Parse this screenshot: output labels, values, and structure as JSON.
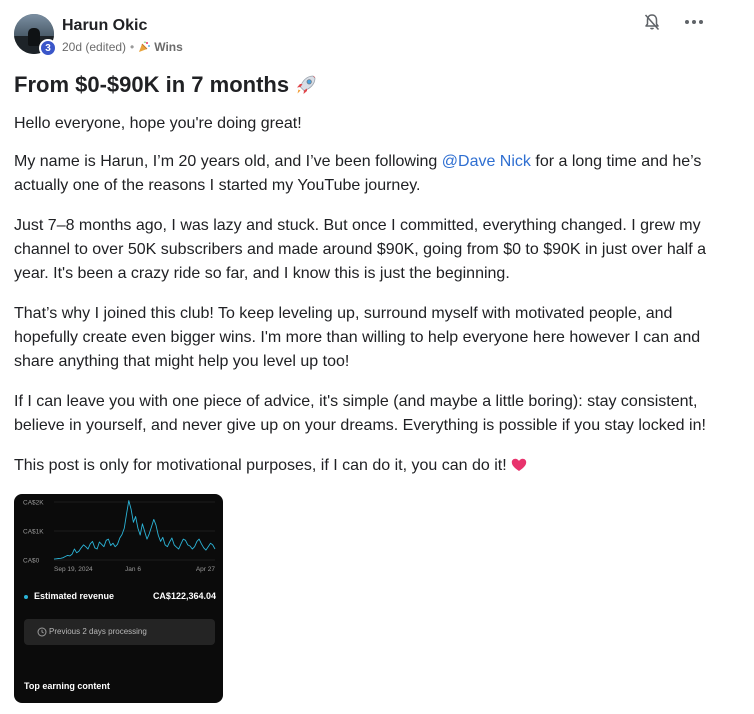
{
  "post": {
    "author": "Harun Okic",
    "level": "3",
    "time": "20d (edited)",
    "separator": "•",
    "category": "Wins",
    "title": "From $0-$90K in 7 months",
    "paragraphs": {
      "p1": "Hello everyone, hope you're doing great!",
      "p2_before": "My name is Harun, I’m 20 years old, and I’ve been following ",
      "p2_mention": "@Dave Nick",
      "p2_after": " for a long time and he’s actually one of the reasons I started my YouTube journey.",
      "p3": "Just 7–8 months ago, I was lazy and stuck. But once I committed, everything changed. I grew my channel to over 50K subscribers and made around $90K, going from $0 to $90K in just over half a year. It's been a crazy ride so far, and I know this is just the beginning.",
      "p4": "That’s why I joined this club! To keep leveling up, surround myself with motivated people, and hopefully create even bigger wins. I'm more than willing to help everyone here however I can and share anything that might help you level up too!",
      "p5": "If I can leave you with one piece of advice, it's simple (and maybe a little boring): stay consistent, believe in yourself, and never give up on your dreams. Everything is possible if you stay locked in!",
      "p6": "This post is only for motivational purposes, if I can do it, you can do it!"
    },
    "icons": {
      "bell": "bell-off-icon",
      "more": "more-horizontal-icon",
      "title_emoji": "rocket-icon",
      "end_emoji": "heart-icon",
      "category": "party-popper-icon"
    },
    "colors": {
      "mention": "#2f6fd1",
      "level_badge": "#3a56c9",
      "chart_line": "#2bb3d6",
      "heart": "#e8336d"
    }
  },
  "attachment": {
    "revenue_label": "Estimated revenue",
    "revenue_value": "CA$122,364.04",
    "processing_note": "Previous 2 days processing",
    "top_earning": "Top earning content",
    "chart_data": {
      "type": "line",
      "y_tick_labels": [
        "CA$2K",
        "CA$1K",
        "CA$0"
      ],
      "x_tick_labels": [
        "Sep 19, 2024",
        "Jan 6",
        "Apr 27"
      ],
      "ylim": [
        0,
        2000
      ],
      "series": [
        {
          "values": [
            30,
            40,
            50,
            60,
            80,
            120,
            160,
            140,
            200,
            380,
            250,
            300,
            420,
            520,
            460,
            380,
            560,
            640,
            420,
            380,
            620,
            540,
            460,
            680,
            720,
            500,
            580,
            460,
            540,
            760,
            880,
            1100,
            1600,
            2050,
            1750,
            1300,
            1500,
            1100,
            860,
            1250,
            980,
            720,
            900,
            1150,
            1400,
            1200,
            850,
            640,
            780,
            520,
            460,
            620,
            760,
            520,
            440,
            380,
            560,
            720,
            680,
            520,
            480,
            380,
            460,
            640,
            720,
            560,
            420,
            340,
            460,
            580,
            520,
            380
          ]
        }
      ]
    }
  }
}
